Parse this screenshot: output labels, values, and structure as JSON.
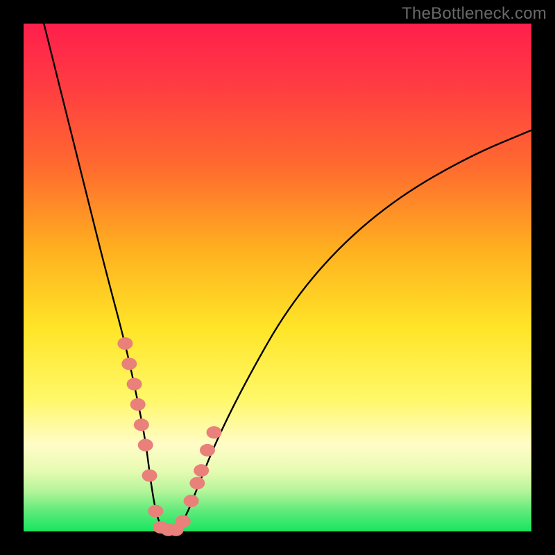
{
  "watermark": "TheBottleneck.com",
  "chart_data": {
    "type": "line",
    "title": "",
    "xlabel": "",
    "ylabel": "",
    "xlim": [
      0,
      100
    ],
    "ylim": [
      0,
      100
    ],
    "series": [
      {
        "name": "curve",
        "x": [
          4,
          8,
          12,
          16,
          20,
          22,
          24,
          25,
          26,
          27,
          28,
          30,
          32,
          34,
          38,
          44,
          52,
          62,
          74,
          88,
          100
        ],
        "y": [
          100,
          84,
          68,
          52,
          37,
          28,
          18,
          10,
          4,
          1,
          0,
          0,
          3,
          8,
          18,
          30,
          44,
          56,
          66,
          74,
          79
        ]
      }
    ],
    "markers": {
      "name": "highlighted-points",
      "color": "#e98079",
      "x": [
        20.0,
        20.8,
        21.8,
        22.5,
        23.2,
        24.0,
        24.8,
        26.0,
        27.0,
        28.5,
        30.0,
        31.4,
        33.0,
        34.2,
        35.0,
        36.2,
        37.5
      ],
      "y": [
        37.0,
        33.0,
        29.0,
        25.0,
        21.0,
        17.0,
        11.0,
        4.0,
        0.8,
        0.3,
        0.3,
        2.0,
        6.0,
        9.5,
        12.0,
        16.0,
        19.5
      ]
    },
    "background_gradient": {
      "top": "#ff1f4c",
      "mid": "#ffe528",
      "bottom": "#18e65f"
    }
  }
}
